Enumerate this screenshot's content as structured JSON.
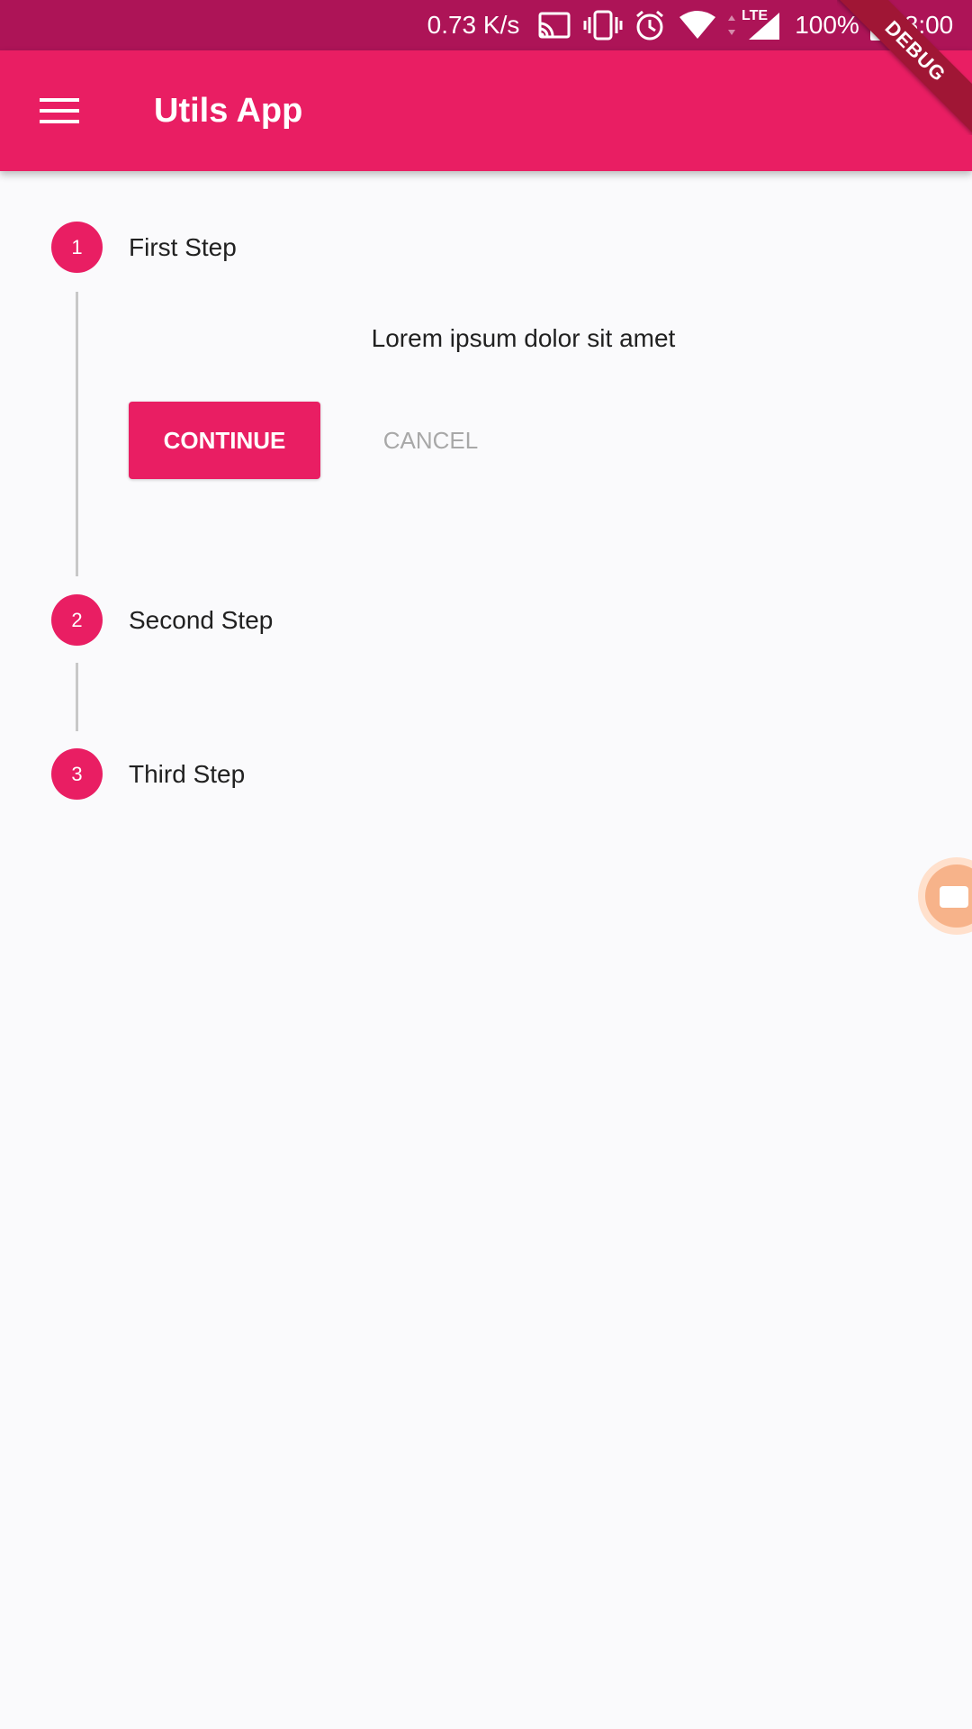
{
  "status_bar": {
    "net_speed": "0.73 K/s",
    "network_type": "LTE",
    "battery": "100%",
    "time": "8:00",
    "icons": [
      "cast-icon",
      "vibrate-icon",
      "alarm-icon",
      "wifi-icon",
      "signal-icon",
      "battery-icon"
    ]
  },
  "app_bar": {
    "title": "Utils App",
    "menu_icon": "hamburger-menu-icon"
  },
  "debug_banner": "DEBUG",
  "stepper": {
    "steps": [
      {
        "number": "1",
        "title": "First Step"
      },
      {
        "number": "2",
        "title": "Second Step"
      },
      {
        "number": "3",
        "title": "Third Step"
      }
    ],
    "content_text": "Lorem ipsum dolor sit amet",
    "continue_label": "CONTINUE",
    "cancel_label": "CANCEL"
  },
  "floating_button": {
    "icon": "video-camera-icon"
  },
  "colors": {
    "primary": "#e91e63",
    "primary_dark": "#ad1457",
    "background": "#fafafc",
    "disabled_text": "#a8a8a8"
  }
}
